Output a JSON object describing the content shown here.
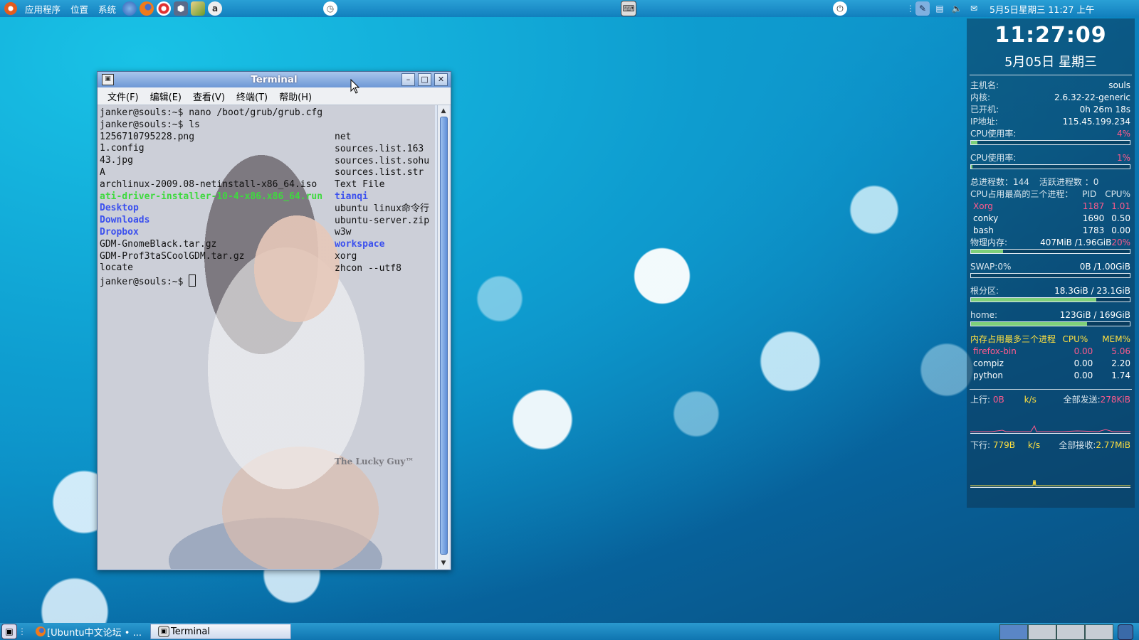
{
  "top_panel": {
    "menus": [
      "应用程序",
      "位置",
      "系统"
    ],
    "clock": "5月5日星期三 11:27 上午"
  },
  "terminal": {
    "title": "Terminal",
    "menus": [
      "文件(F)",
      "编辑(E)",
      "查看(V)",
      "终端(T)",
      "帮助(H)"
    ],
    "line1": "janker@souls:~$ nano /boot/grub/grub.cfg",
    "line2": "janker@souls:~$ ls",
    "col1": [
      "1256710795228.png",
      "1.config",
      "43.jpg",
      "A",
      "archlinux-2009.08-netinstall-x86_64.iso",
      "ati-driver-installer-10-4-x86.x86_64.run",
      "Desktop",
      "Downloads",
      "Dropbox",
      "GDM-GnomeBlack.tar.gz",
      "GDM-Prof3taSCoolGDM.tar.gz",
      "locate"
    ],
    "col2": [
      "net",
      "sources.list.163",
      "sources.list.sohu",
      "sources.list.str",
      "Text File",
      "tianqi",
      "ubuntu linux命令行",
      "ubuntu-server.zip",
      "w3w",
      "workspace",
      "xorg",
      "zhcon --utf8"
    ],
    "prompt": "janker@souls:~$ ",
    "watermark": "The Lucky Guy™"
  },
  "conky": {
    "time": "11:27:09",
    "date": "5月05日 星期三",
    "hostname_label": "主机名:",
    "hostname": "souls",
    "kernel_label": "内核:",
    "kernel": "2.6.32-22-generic",
    "uptime_label": "已开机:",
    "uptime": "0h 26m 18s",
    "ip_label": "IP地址:",
    "ip": "115.45.199.234",
    "cpu1_label": "CPU使用率:",
    "cpu1": "4%",
    "cpu1_level": 0.04,
    "cpu2_label": "CPU使用率:",
    "cpu2": "1%",
    "cpu2_level": 0.01,
    "procs": "总进程数：144",
    "running": "活跃进程数 ：0",
    "top_cpu_header": "CPU占用最高的三个进程：",
    "pid_header": "PID",
    "cpu_header": "CPU%",
    "top_cpu": [
      {
        "name": "Xorg",
        "pid": "1187",
        "cpu": "1.01"
      },
      {
        "name": "conky",
        "pid": "1690",
        "cpu": "0.50"
      },
      {
        "name": "bash",
        "pid": "1783",
        "cpu": "0.00"
      }
    ],
    "mem_label": "物理内存:",
    "mem": "407MiB  /1.96GiB",
    "mem_pct": "20%",
    "mem_level": 0.2,
    "swap_label": "SWAP:0%",
    "swap": "0B    /1.00GiB",
    "swap_level": 0.0,
    "root_label": "根分区:",
    "root": "18.3GiB / 23.1GiB",
    "root_level": 0.79,
    "home_label": "home:",
    "home": "123GiB  / 169GiB",
    "home_level": 0.73,
    "top_mem_header": "内存占用最多三个进程",
    "mem_cpu_header": "CPU%",
    "mem_mem_header": "MEM%",
    "top_mem": [
      {
        "name": "firefox-bin",
        "cpu": "0.00",
        "mem": "5.06"
      },
      {
        "name": "compiz",
        "cpu": "0.00",
        "mem": "2.20"
      },
      {
        "name": "python",
        "cpu": "0.00",
        "mem": "1.74"
      }
    ],
    "up_label": "上行:",
    "up": "0B",
    "up_unit": "k/s",
    "sent_label": "全部发送:",
    "sent": "278KiB",
    "down_label": "下行:",
    "down": "779B",
    "down_unit": "k/s",
    "recv_label": "全部接收:",
    "recv": "2.77MiB"
  },
  "bottom_panel": {
    "tasks": [
      "[Ubuntu中文论坛 • ...",
      "Terminal"
    ]
  },
  "colors": {
    "panel": "#117fbd",
    "titlebar": "#6e98d6",
    "dir": "#3b50ee",
    "exe": "#3fd93f",
    "conky_hot": "#ff5a8c"
  }
}
